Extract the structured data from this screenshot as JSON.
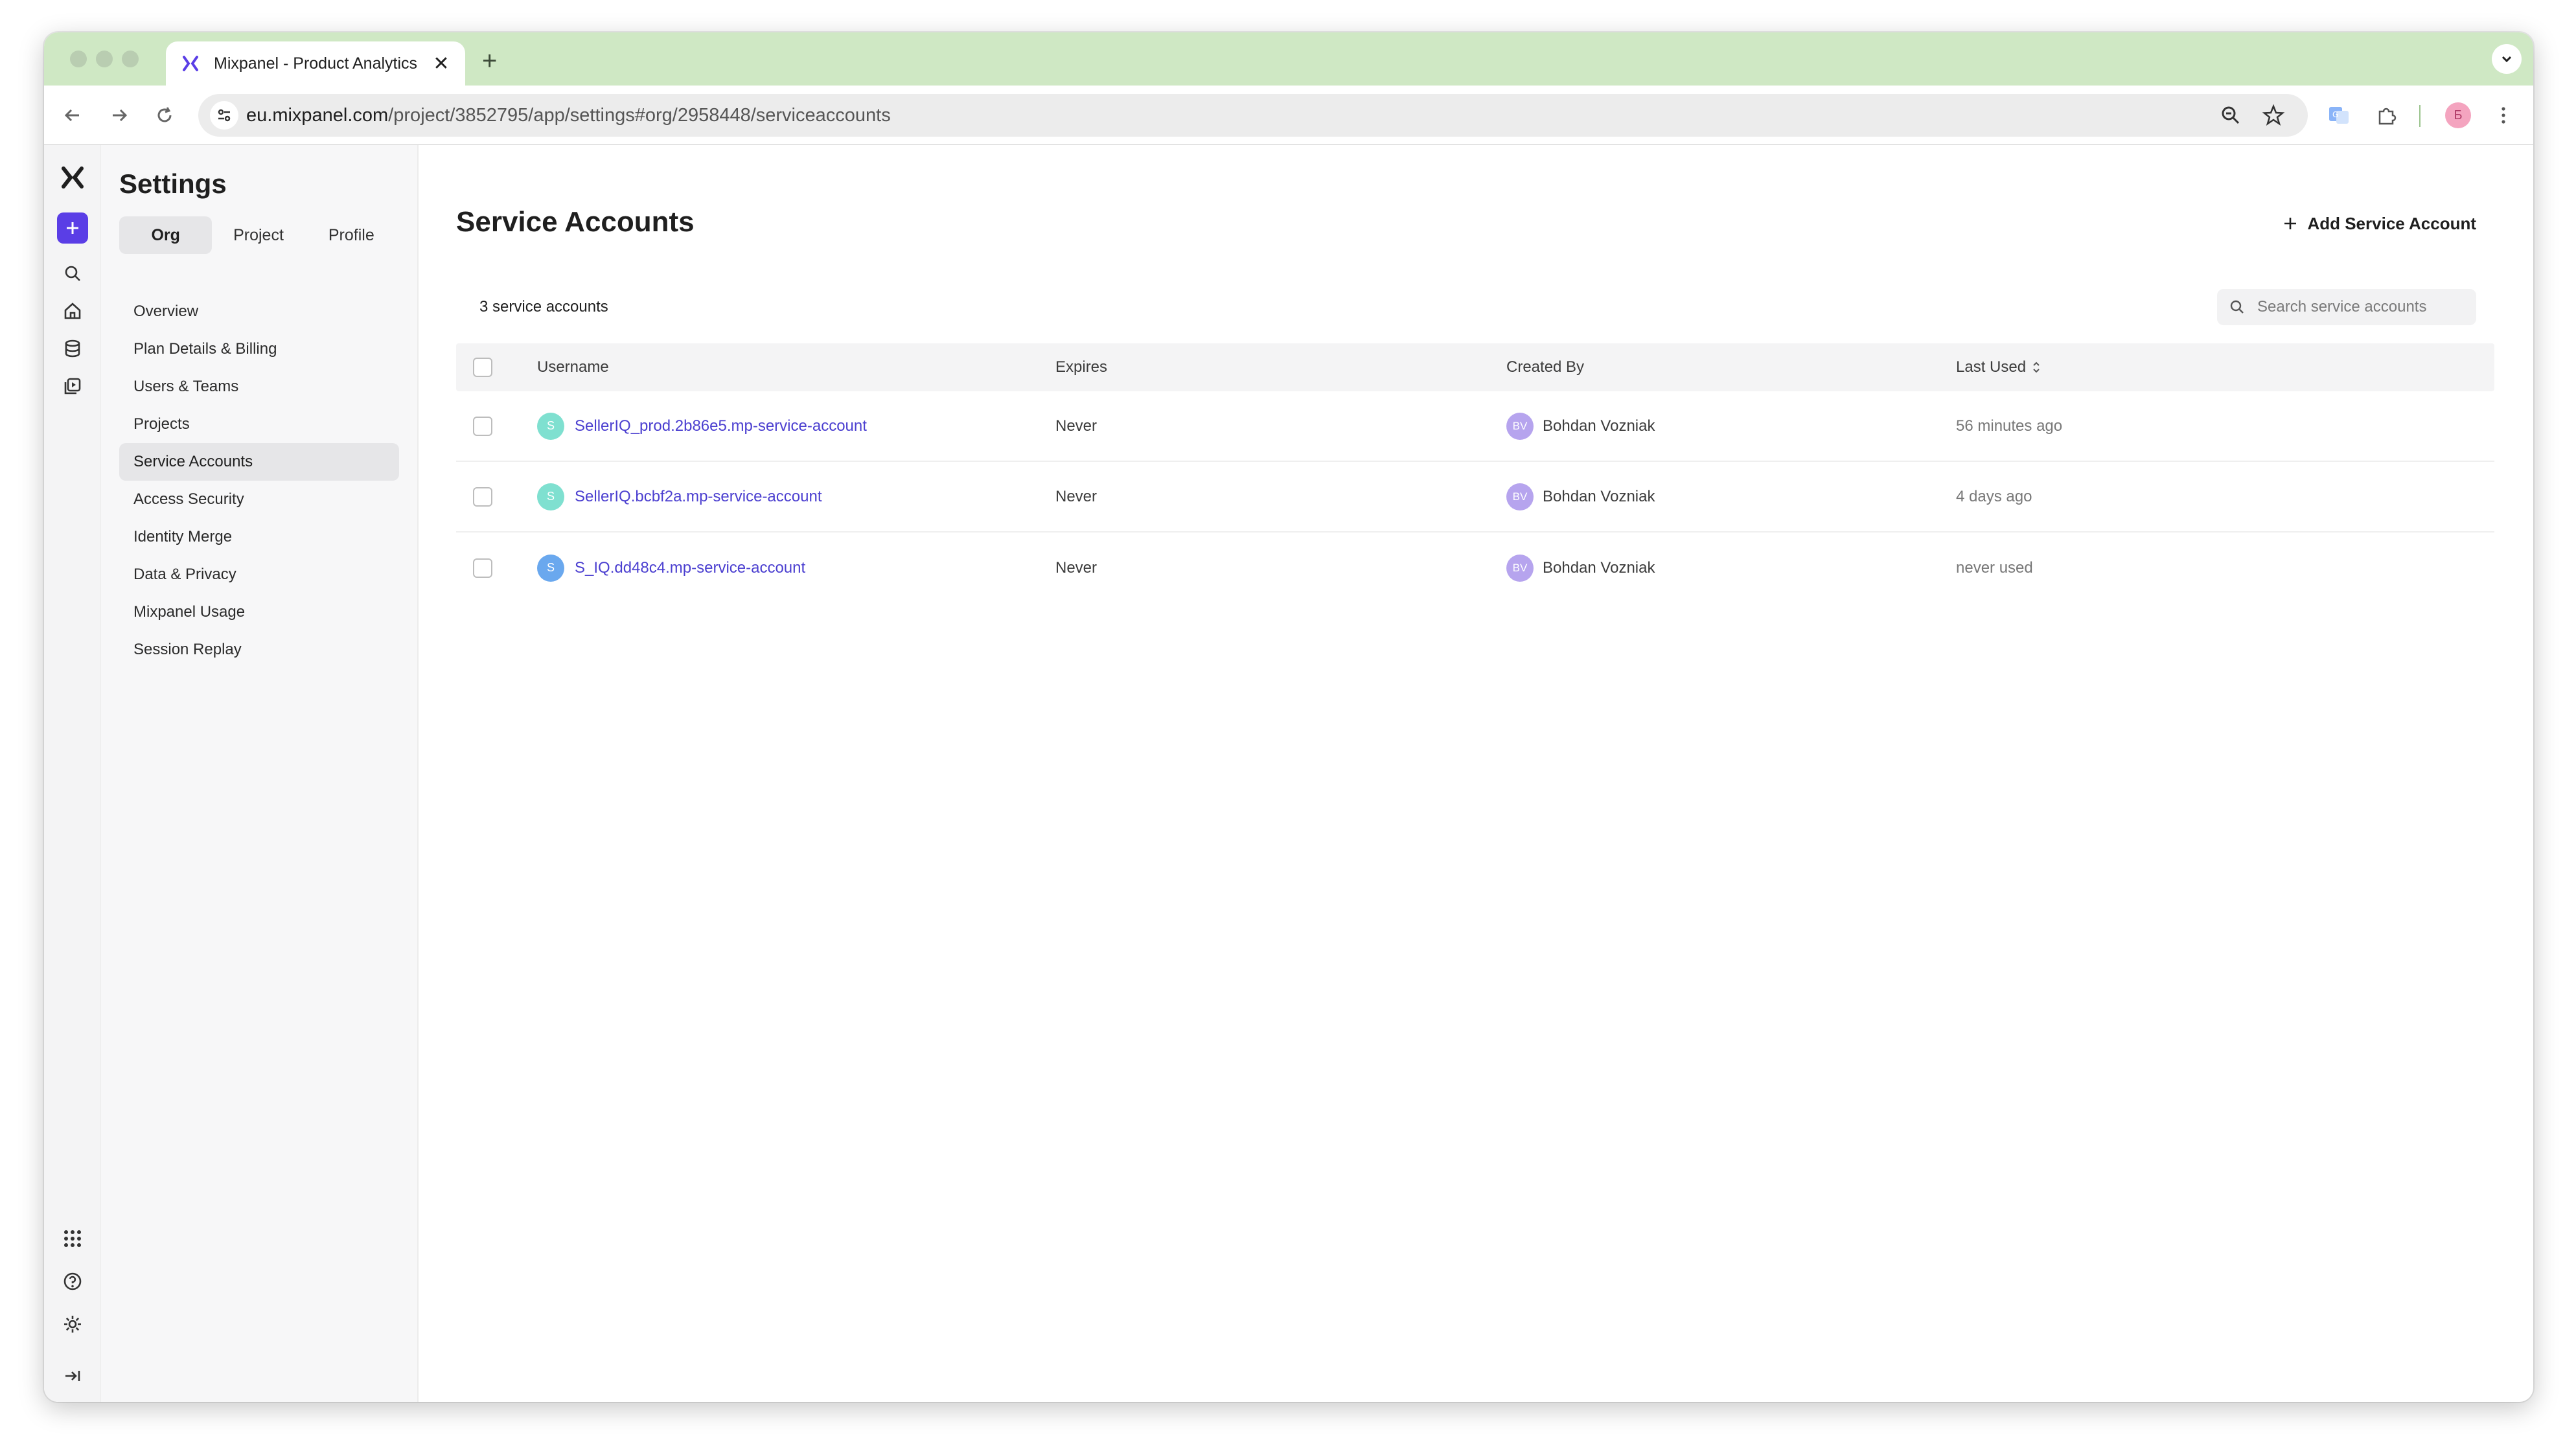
{
  "browser": {
    "tab_title": "Mixpanel - Product Analytics",
    "url_host": "eu.mixpanel.com",
    "url_path": "/project/3852795/app/settings#org/2958448/serviceaccounts",
    "profile_initial": "Б"
  },
  "settings": {
    "title": "Settings",
    "tabs": [
      "Org",
      "Project",
      "Profile"
    ],
    "active_tab": "Org",
    "nav_items": [
      "Overview",
      "Plan Details & Billing",
      "Users & Teams",
      "Projects",
      "Service Accounts",
      "Access Security",
      "Identity Merge",
      "Data & Privacy",
      "Mixpanel Usage",
      "Session Replay"
    ],
    "active_nav": "Service Accounts"
  },
  "main": {
    "title": "Service Accounts",
    "add_button_label": "Add Service Account",
    "count_text": "3 service accounts",
    "search_placeholder": "Search service accounts"
  },
  "table": {
    "columns": [
      "Username",
      "Expires",
      "Created By",
      "Last Used"
    ],
    "rows": [
      {
        "avatar_letter": "S",
        "avatar_color": "#7fe0d0",
        "username": "SellerIQ_prod.2b86e5.mp-service-account",
        "expires": "Never",
        "created_by_initials": "BV",
        "created_by": "Bohdan Vozniak",
        "last_used": "56 minutes ago"
      },
      {
        "avatar_letter": "S",
        "avatar_color": "#7fe0d0",
        "username": "SellerIQ.bcbf2a.mp-service-account",
        "expires": "Never",
        "created_by_initials": "BV",
        "created_by": "Bohdan Vozniak",
        "last_used": "4 days ago"
      },
      {
        "avatar_letter": "S",
        "avatar_color": "#6aa8ee",
        "username": "S_IQ.dd48c4.mp-service-account",
        "expires": "Never",
        "created_by_initials": "BV",
        "created_by": "Bohdan Vozniak",
        "last_used": "never used"
      }
    ]
  },
  "colors": {
    "accent": "#5a3ee6",
    "link": "#4b3fd0",
    "tabstrip": "#cfe8c4"
  }
}
